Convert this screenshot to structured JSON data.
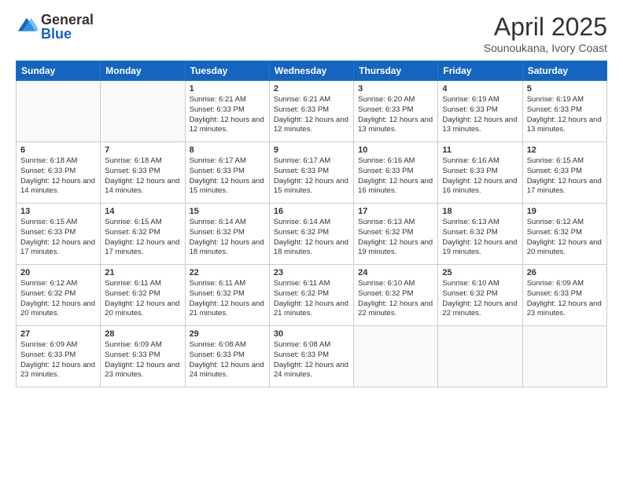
{
  "logo": {
    "general": "General",
    "blue": "Blue"
  },
  "title": "April 2025",
  "subtitle": "Sounoukana, Ivory Coast",
  "days_of_week": [
    "Sunday",
    "Monday",
    "Tuesday",
    "Wednesday",
    "Thursday",
    "Friday",
    "Saturday"
  ],
  "weeks": [
    [
      {
        "day": null,
        "info": null
      },
      {
        "day": null,
        "info": null
      },
      {
        "day": "1",
        "info": "Sunrise: 6:21 AM\nSunset: 6:33 PM\nDaylight: 12 hours and 12 minutes."
      },
      {
        "day": "2",
        "info": "Sunrise: 6:21 AM\nSunset: 6:33 PM\nDaylight: 12 hours and 12 minutes."
      },
      {
        "day": "3",
        "info": "Sunrise: 6:20 AM\nSunset: 6:33 PM\nDaylight: 12 hours and 13 minutes."
      },
      {
        "day": "4",
        "info": "Sunrise: 6:19 AM\nSunset: 6:33 PM\nDaylight: 12 hours and 13 minutes."
      },
      {
        "day": "5",
        "info": "Sunrise: 6:19 AM\nSunset: 6:33 PM\nDaylight: 12 hours and 13 minutes."
      }
    ],
    [
      {
        "day": "6",
        "info": "Sunrise: 6:18 AM\nSunset: 6:33 PM\nDaylight: 12 hours and 14 minutes."
      },
      {
        "day": "7",
        "info": "Sunrise: 6:18 AM\nSunset: 6:33 PM\nDaylight: 12 hours and 14 minutes."
      },
      {
        "day": "8",
        "info": "Sunrise: 6:17 AM\nSunset: 6:33 PM\nDaylight: 12 hours and 15 minutes."
      },
      {
        "day": "9",
        "info": "Sunrise: 6:17 AM\nSunset: 6:33 PM\nDaylight: 12 hours and 15 minutes."
      },
      {
        "day": "10",
        "info": "Sunrise: 6:16 AM\nSunset: 6:33 PM\nDaylight: 12 hours and 16 minutes."
      },
      {
        "day": "11",
        "info": "Sunrise: 6:16 AM\nSunset: 6:33 PM\nDaylight: 12 hours and 16 minutes."
      },
      {
        "day": "12",
        "info": "Sunrise: 6:15 AM\nSunset: 6:33 PM\nDaylight: 12 hours and 17 minutes."
      }
    ],
    [
      {
        "day": "13",
        "info": "Sunrise: 6:15 AM\nSunset: 6:33 PM\nDaylight: 12 hours and 17 minutes."
      },
      {
        "day": "14",
        "info": "Sunrise: 6:15 AM\nSunset: 6:32 PM\nDaylight: 12 hours and 17 minutes."
      },
      {
        "day": "15",
        "info": "Sunrise: 6:14 AM\nSunset: 6:32 PM\nDaylight: 12 hours and 18 minutes."
      },
      {
        "day": "16",
        "info": "Sunrise: 6:14 AM\nSunset: 6:32 PM\nDaylight: 12 hours and 18 minutes."
      },
      {
        "day": "17",
        "info": "Sunrise: 6:13 AM\nSunset: 6:32 PM\nDaylight: 12 hours and 19 minutes."
      },
      {
        "day": "18",
        "info": "Sunrise: 6:13 AM\nSunset: 6:32 PM\nDaylight: 12 hours and 19 minutes."
      },
      {
        "day": "19",
        "info": "Sunrise: 6:12 AM\nSunset: 6:32 PM\nDaylight: 12 hours and 20 minutes."
      }
    ],
    [
      {
        "day": "20",
        "info": "Sunrise: 6:12 AM\nSunset: 6:32 PM\nDaylight: 12 hours and 20 minutes."
      },
      {
        "day": "21",
        "info": "Sunrise: 6:11 AM\nSunset: 6:32 PM\nDaylight: 12 hours and 20 minutes."
      },
      {
        "day": "22",
        "info": "Sunrise: 6:11 AM\nSunset: 6:32 PM\nDaylight: 12 hours and 21 minutes."
      },
      {
        "day": "23",
        "info": "Sunrise: 6:11 AM\nSunset: 6:32 PM\nDaylight: 12 hours and 21 minutes."
      },
      {
        "day": "24",
        "info": "Sunrise: 6:10 AM\nSunset: 6:32 PM\nDaylight: 12 hours and 22 minutes."
      },
      {
        "day": "25",
        "info": "Sunrise: 6:10 AM\nSunset: 6:32 PM\nDaylight: 12 hours and 22 minutes."
      },
      {
        "day": "26",
        "info": "Sunrise: 6:09 AM\nSunset: 6:33 PM\nDaylight: 12 hours and 23 minutes."
      }
    ],
    [
      {
        "day": "27",
        "info": "Sunrise: 6:09 AM\nSunset: 6:33 PM\nDaylight: 12 hours and 23 minutes."
      },
      {
        "day": "28",
        "info": "Sunrise: 6:09 AM\nSunset: 6:33 PM\nDaylight: 12 hours and 23 minutes."
      },
      {
        "day": "29",
        "info": "Sunrise: 6:08 AM\nSunset: 6:33 PM\nDaylight: 12 hours and 24 minutes."
      },
      {
        "day": "30",
        "info": "Sunrise: 6:08 AM\nSunset: 6:33 PM\nDaylight: 12 hours and 24 minutes."
      },
      {
        "day": null,
        "info": null
      },
      {
        "day": null,
        "info": null
      },
      {
        "day": null,
        "info": null
      }
    ]
  ]
}
